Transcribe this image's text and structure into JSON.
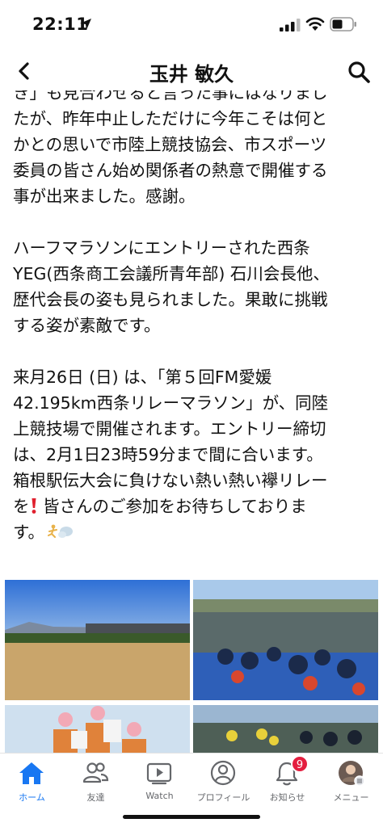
{
  "status_bar": {
    "time": "22:11"
  },
  "header": {
    "title": "玉井 敏久"
  },
  "post": {
    "lines_a": [
      "き」も見合わせると言った事にはなりまし",
      "たが、昨年中止しただけに今年こそは何と",
      "かとの思いで市陸上競技協会、市スポーツ",
      "委員の皆さん始め関係者の熱意で開催する",
      "事が出来ました。感謝。"
    ],
    "lines_b": [
      "ハーフマラソンにエントリーされた西条",
      "YEG(西条商工会議所青年部) 石川会長他、",
      "歴代会長の姿も見られました。果敢に挑戦",
      "する姿が素敵です。"
    ],
    "lines_c": [
      "来月26日 (日) は、「第５回FM愛媛",
      "42.195km西条リレーマラソン」が、同陸",
      "上競技場で開催されます。エントリー締切",
      "は、2月1日23時59分まで間に合います。",
      "箱根駅伝大会に負けない熱い熱い襷リレー"
    ],
    "line_c6_before": "を",
    "line_c6_after": " 皆さんのご参加をお待ちしておりま",
    "line_c7": "す。"
  },
  "photos": [
    {
      "name": "stadium-field-photo"
    },
    {
      "name": "runners-start-line-photo"
    },
    {
      "name": "volunteers-photo"
    },
    {
      "name": "runners-track-photo"
    }
  ],
  "tabbar": {
    "tabs": [
      {
        "label": "ホーム",
        "icon": "home-icon",
        "active": true
      },
      {
        "label": "友達",
        "icon": "friends-icon"
      },
      {
        "label": "Watch",
        "icon": "watch-icon"
      },
      {
        "label": "プロフィール",
        "icon": "profile-icon"
      },
      {
        "label": "お知らせ",
        "icon": "bell-icon",
        "badge": "9"
      },
      {
        "label": "メニュー",
        "icon": "menu-avatar-icon"
      }
    ]
  },
  "colors": {
    "accent": "#1877f2",
    "badge": "#e41e3f",
    "inactive": "#65676b"
  }
}
